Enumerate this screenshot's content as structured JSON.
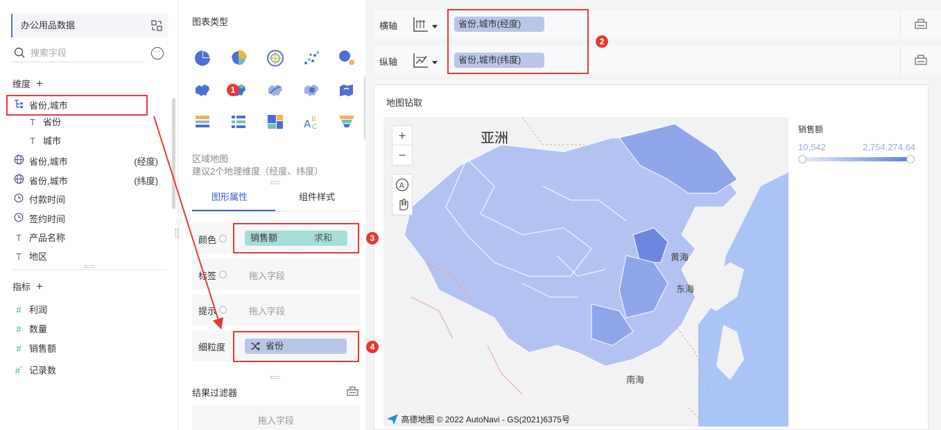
{
  "dataset": {
    "name": "办公用品数据"
  },
  "search": {
    "placeholder": "搜索字段"
  },
  "dimensions": {
    "label": "维度",
    "items": [
      {
        "label": "省份,城市",
        "icon": "hierarchy-icon"
      },
      {
        "label": "省份",
        "icon": "text-icon"
      },
      {
        "label": "城市",
        "icon": "text-icon"
      },
      {
        "label": "省份,城市",
        "suffix": "(经度)",
        "icon": "globe-icon"
      },
      {
        "label": "省份,城市",
        "suffix": "(纬度)",
        "icon": "globe-icon"
      },
      {
        "label": "付款时间",
        "icon": "clock-icon"
      },
      {
        "label": "签约时间",
        "icon": "clock-icon"
      },
      {
        "label": "产品名称",
        "icon": "text-icon"
      },
      {
        "label": "地区",
        "icon": "text-icon"
      }
    ]
  },
  "metrics": {
    "label": "指标",
    "items": [
      {
        "label": "利润",
        "icon": "hash-icon"
      },
      {
        "label": "数量",
        "icon": "hash-icon"
      },
      {
        "label": "销售额",
        "icon": "hash-icon"
      },
      {
        "label": "记录数",
        "icon": "hash-star-icon"
      }
    ]
  },
  "chart_types": {
    "title": "图表类型",
    "selected_name": "区域地图",
    "selected_desc": "建议2个地理维度（经度、纬度）"
  },
  "tabs": [
    {
      "label": "图形属性"
    },
    {
      "label": "组件样式"
    }
  ],
  "properties": {
    "color": {
      "label": "颜色",
      "field": "销售额",
      "agg": "求和"
    },
    "tag": {
      "label": "标签",
      "placeholder": "拖入字段"
    },
    "tooltip": {
      "label": "提示",
      "placeholder": "拖入字段"
    },
    "granularity": {
      "label": "细粒度",
      "field": "省份"
    }
  },
  "result_filter": {
    "title": "结果过滤器",
    "placeholder": "拖入字段"
  },
  "axes": {
    "x": {
      "label": "横轴",
      "field": "省份,城市(经度)"
    },
    "y": {
      "label": "纵轴",
      "field": "省份,城市(纬度)"
    }
  },
  "chart": {
    "title": "地图钻取",
    "map_labels": {
      "continent": "亚洲",
      "yellow_sea": "黄海",
      "east_sea": "东海",
      "south_sea": "南海"
    },
    "attribution": "高德地图 © 2022 AutoNavi - GS(2021)6375号",
    "legend": {
      "title": "销售额",
      "min": "10,542",
      "max": "2,754,274.64"
    },
    "zoom_in": "+",
    "zoom_out": "−"
  },
  "annotations": [
    "1",
    "2",
    "3",
    "4"
  ],
  "colors": {
    "accent": "#3b5bd9",
    "highlight": "#e53935",
    "pill": "#b8c6ea",
    "measure_pill": "#a8ddd4",
    "sea": "#a9c4f5"
  }
}
